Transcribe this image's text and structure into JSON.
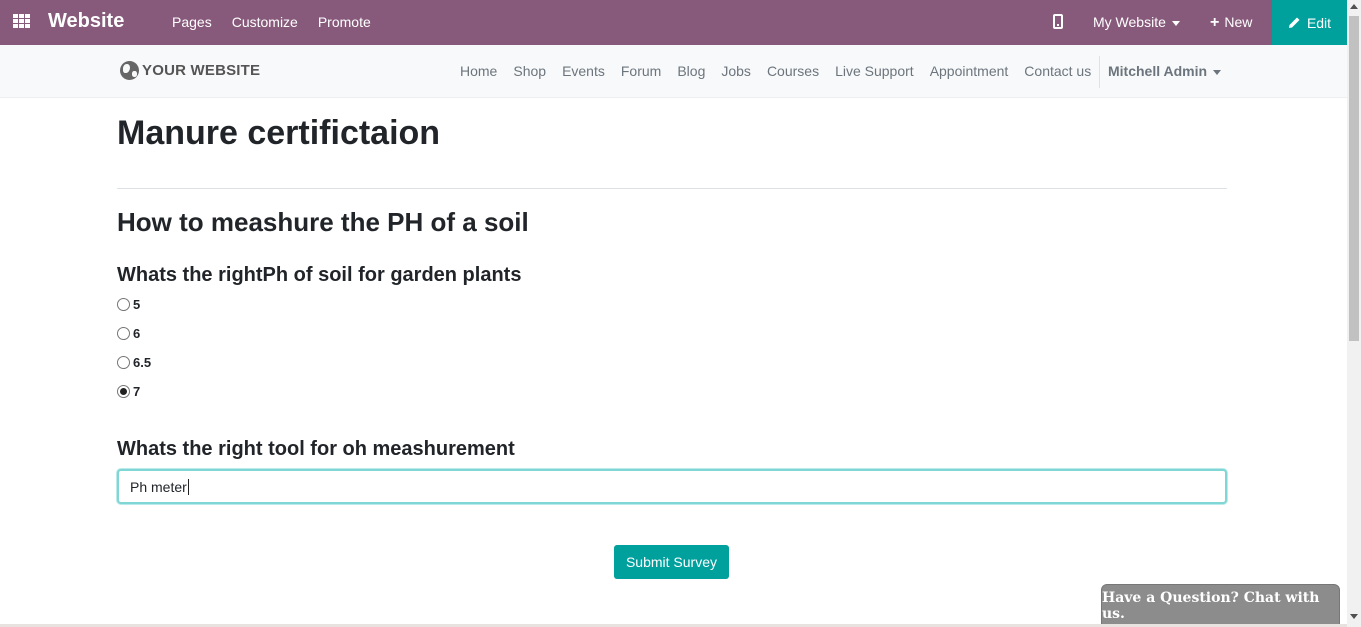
{
  "adminbar": {
    "brand": "Website",
    "menu": [
      "Pages",
      "Customize",
      "Promote"
    ],
    "website_selector": "My Website",
    "new_label": "New",
    "edit_label": "Edit",
    "color": "#875a7b",
    "edit_color": "#00a09d"
  },
  "site": {
    "logo_text": "YOUR WEBSITE",
    "nav": [
      "Home",
      "Shop",
      "Events",
      "Forum",
      "Blog",
      "Jobs",
      "Courses",
      "Live Support",
      "Appointment",
      "Contact us"
    ],
    "user": "Mitchell Admin"
  },
  "survey": {
    "title": "Manure certifictaion",
    "section": "How to meashure the PH of a soil",
    "question1": {
      "text": "Whats the rightPh of soil for garden plants",
      "options": [
        "5",
        "6",
        "6.5",
        "7"
      ],
      "selected": "7"
    },
    "question2": {
      "text": "Whats the right tool for oh meashurement",
      "answer": "Ph meter"
    },
    "submit_label": "Submit Survey"
  },
  "chat": {
    "label": "Have a Question? Chat with us."
  }
}
